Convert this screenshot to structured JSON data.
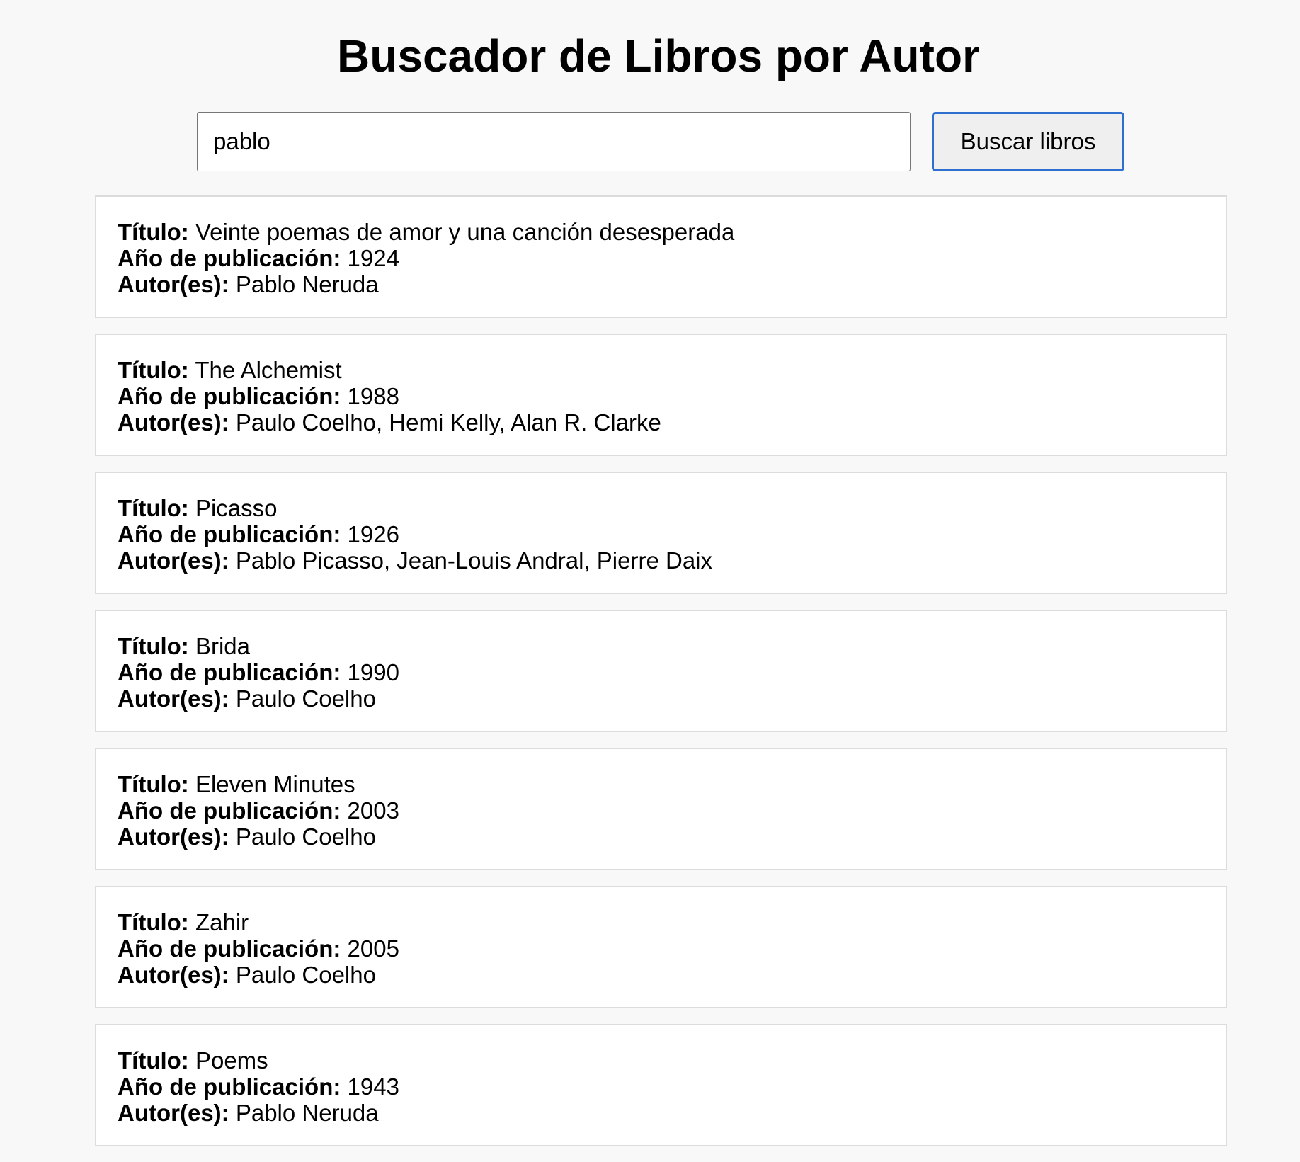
{
  "page": {
    "title": "Buscador de Libros por Autor"
  },
  "search": {
    "value": "pablo",
    "button_label": "Buscar libros"
  },
  "labels": {
    "title": "Título:",
    "year": "Año de publicación:",
    "authors": "Autor(es):"
  },
  "results": [
    {
      "title": "Veinte poemas de amor y una canción desesperada",
      "year": "1924",
      "authors": "Pablo Neruda"
    },
    {
      "title": "The Alchemist",
      "year": "1988",
      "authors": "Paulo Coelho, Hemi Kelly, Alan R. Clarke"
    },
    {
      "title": "Picasso",
      "year": "1926",
      "authors": "Pablo Picasso, Jean-Louis Andral, Pierre Daix"
    },
    {
      "title": "Brida",
      "year": "1990",
      "authors": "Paulo Coelho"
    },
    {
      "title": "Eleven Minutes",
      "year": "2003",
      "authors": "Paulo Coelho"
    },
    {
      "title": "Zahir",
      "year": "2005",
      "authors": "Paulo Coelho"
    },
    {
      "title": "Poems",
      "year": "1943",
      "authors": "Pablo Neruda"
    }
  ],
  "colors": {
    "background": "#f8f8f8",
    "card_background": "#ffffff",
    "card_border": "#dcdcdc",
    "button_focus_border": "#2f6fd0",
    "button_background": "#efefef"
  }
}
